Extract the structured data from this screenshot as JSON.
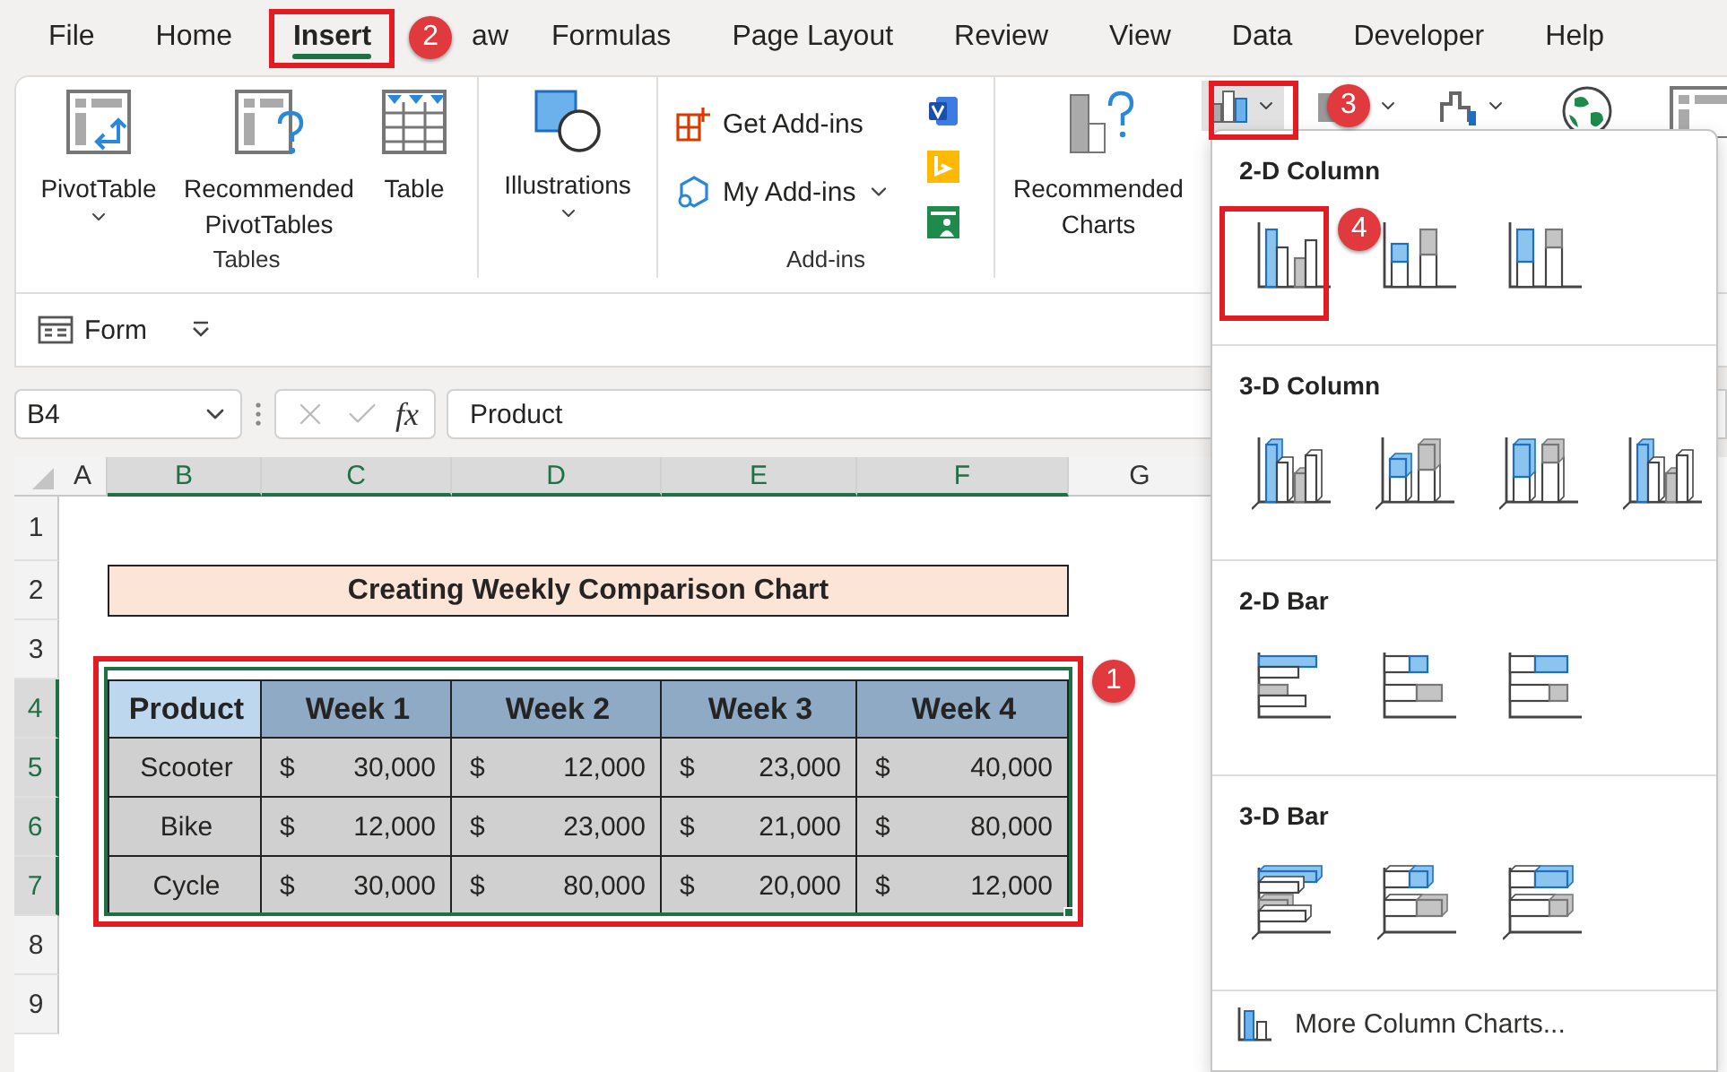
{
  "menu_tabs": [
    {
      "label": "File",
      "selected": false
    },
    {
      "label": "Home",
      "selected": false
    },
    {
      "label": "Insert",
      "selected": true
    },
    {
      "label": "aw",
      "selected": false
    },
    {
      "label": "Formulas",
      "selected": false
    },
    {
      "label": "Page Layout",
      "selected": false
    },
    {
      "label": "Review",
      "selected": false
    },
    {
      "label": "View",
      "selected": false
    },
    {
      "label": "Data",
      "selected": false
    },
    {
      "label": "Developer",
      "selected": false
    },
    {
      "label": "Help",
      "selected": false
    }
  ],
  "ribbon": {
    "tables": {
      "label": "Tables",
      "buttons": [
        {
          "label": "PivotTable",
          "kind": "pivot",
          "has_menu": true
        },
        {
          "label": "Recommended PivotTables",
          "kind": "recommended_pivot",
          "has_menu": false
        },
        {
          "label": "Table",
          "kind": "table",
          "has_menu": false
        }
      ]
    },
    "illustrations": {
      "label": "Illustrations",
      "has_menu": true
    },
    "addins": {
      "label": "Add-ins",
      "buttons": [
        {
          "label": "Get Add-ins",
          "kind": "get",
          "has_menu": false
        },
        {
          "label": "My Add-ins",
          "kind": "my",
          "has_menu": true
        }
      ],
      "apps": [
        {
          "kind": "visio"
        },
        {
          "kind": "bing"
        },
        {
          "kind": "people"
        }
      ]
    },
    "recommended_charts": {
      "label": "Recommended Charts"
    },
    "chart_buttons": [
      {
        "kind": "column",
        "open": true,
        "has_menu": true
      },
      {
        "kind": "hierarchy",
        "open": false,
        "has_menu": true
      },
      {
        "kind": "waterfall",
        "open": false,
        "has_menu": true
      },
      {
        "kind": "map",
        "open": false,
        "has_menu": false
      },
      {
        "kind": "pivot_chart",
        "open": false,
        "has_menu": false
      }
    ],
    "form": {
      "label": "Form"
    }
  },
  "formula_bar": {
    "name_box": "B4",
    "fx": "fx",
    "value": "Product"
  },
  "sheet": {
    "columns": [
      {
        "label": "A",
        "selected": false
      },
      {
        "label": "B",
        "selected": true
      },
      {
        "label": "C",
        "selected": true
      },
      {
        "label": "D",
        "selected": true
      },
      {
        "label": "E",
        "selected": true
      },
      {
        "label": "F",
        "selected": true
      },
      {
        "label": "G",
        "selected": false
      }
    ],
    "rows": [
      {
        "label": "1",
        "selected": false
      },
      {
        "label": "2",
        "selected": false
      },
      {
        "label": "3",
        "selected": false
      },
      {
        "label": "4",
        "selected": true
      },
      {
        "label": "5",
        "selected": true
      },
      {
        "label": "6",
        "selected": true
      },
      {
        "label": "7",
        "selected": true
      },
      {
        "label": "8",
        "selected": false
      },
      {
        "label": "9",
        "selected": false
      }
    ],
    "title": "Creating Weekly Comparison Chart",
    "table": {
      "columns": [
        "Product",
        "Week 1",
        "Week 2",
        "Week 3",
        "Week 4"
      ],
      "rows": [
        {
          "product": "Scooter",
          "values": [
            {
              "currency": "$",
              "amount": "30,000"
            },
            {
              "currency": "$",
              "amount": "12,000"
            },
            {
              "currency": "$",
              "amount": "23,000"
            },
            {
              "currency": "$",
              "amount": "40,000"
            }
          ]
        },
        {
          "product": "Bike",
          "values": [
            {
              "currency": "$",
              "amount": "12,000"
            },
            {
              "currency": "$",
              "amount": "23,000"
            },
            {
              "currency": "$",
              "amount": "21,000"
            },
            {
              "currency": "$",
              "amount": "80,000"
            }
          ]
        },
        {
          "product": "Cycle",
          "values": [
            {
              "currency": "$",
              "amount": "30,000"
            },
            {
              "currency": "$",
              "amount": "80,000"
            },
            {
              "currency": "$",
              "amount": "20,000"
            },
            {
              "currency": "$",
              "amount": "12,000"
            }
          ]
        }
      ]
    }
  },
  "chart_menu": {
    "sections": [
      {
        "title": "2-D Column",
        "kind": "column2d",
        "items": [
          {
            "kind": "clustered"
          },
          {
            "kind": "stacked"
          },
          {
            "kind": "percent"
          }
        ]
      },
      {
        "title": "3-D Column",
        "kind": "column3d",
        "items": [
          {
            "kind": "clustered"
          },
          {
            "kind": "stacked"
          },
          {
            "kind": "percent"
          },
          {
            "kind": "staggered"
          }
        ]
      },
      {
        "title": "2-D Bar",
        "kind": "bar2d",
        "items": [
          {
            "kind": "clustered"
          },
          {
            "kind": "stacked"
          },
          {
            "kind": "percent"
          }
        ]
      },
      {
        "title": "3-D Bar",
        "kind": "bar3d",
        "items": [
          {
            "kind": "clustered"
          },
          {
            "kind": "stacked"
          },
          {
            "kind": "percent"
          }
        ]
      }
    ],
    "more": "More Column Charts..."
  },
  "callouts": [
    {
      "label": "1",
      "kind": "table"
    },
    {
      "label": "2",
      "kind": "tab"
    },
    {
      "label": "3",
      "kind": "chart_button"
    },
    {
      "label": "4",
      "kind": "chart_type"
    }
  ]
}
